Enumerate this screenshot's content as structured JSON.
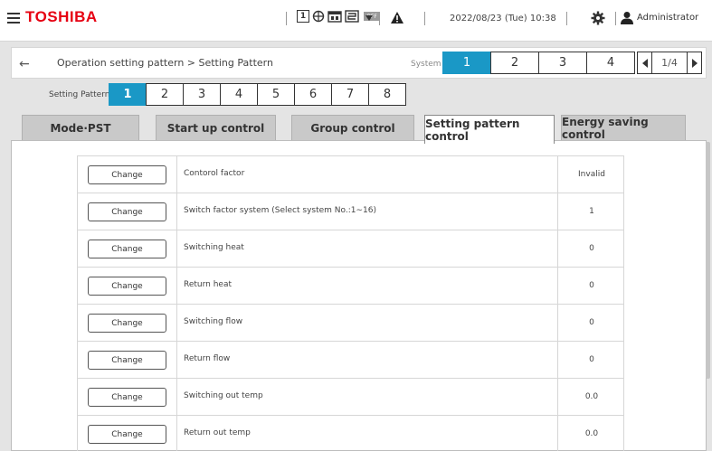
{
  "header": {
    "brand": "TOSHIBA",
    "status_box_label": "1",
    "status_off_label": "OFF",
    "datetime": "2022/08/23 (Tue) 10:38",
    "user": "Administrator"
  },
  "breadcrumb": {
    "text": "Operation setting pattern  >  Setting Pattern",
    "system_label": "System",
    "system_tabs": [
      "1",
      "2",
      "3",
      "4"
    ],
    "system_active": "1",
    "pager_text": "1/4"
  },
  "setting_pattern": {
    "label": "Setting Pattern",
    "tabs": [
      "1",
      "2",
      "3",
      "4",
      "5",
      "6",
      "7",
      "8"
    ],
    "active": "1"
  },
  "main_tabs": [
    {
      "label": "Mode·PST"
    },
    {
      "label": "Start up control"
    },
    {
      "label": "Group control"
    },
    {
      "label": "Setting pattern control"
    },
    {
      "label": "Energy saving control"
    }
  ],
  "active_main_tab": "Setting pattern control",
  "rows": [
    {
      "button": "Change",
      "name": "Contorol factor",
      "value": "Invalid"
    },
    {
      "button": "Change",
      "name": "Switch factor system (Select system No.:1∼16)",
      "value": "1"
    },
    {
      "button": "Change",
      "name": "Switching heat",
      "value": "0"
    },
    {
      "button": "Change",
      "name": "Return heat",
      "value": "0"
    },
    {
      "button": "Change",
      "name": "Switching flow",
      "value": "0"
    },
    {
      "button": "Change",
      "name": "Return flow",
      "value": "0"
    },
    {
      "button": "Change",
      "name": "Switching out temp",
      "value": "0.0"
    },
    {
      "button": "Change",
      "name": "Return out temp",
      "value": "0.0"
    }
  ],
  "colors": {
    "accent": "#1a98c6",
    "brand": "#e60012",
    "tab_inactive": "#c9c9c9",
    "background": "#e4e4e4"
  },
  "icons": [
    "hamburger-menu-icon",
    "status-icons",
    "dropdown-arrow-icon",
    "warning-icon",
    "gear-icon",
    "user-icon",
    "back-arrow-icon",
    "pager-prev-icon",
    "pager-next-icon"
  ]
}
